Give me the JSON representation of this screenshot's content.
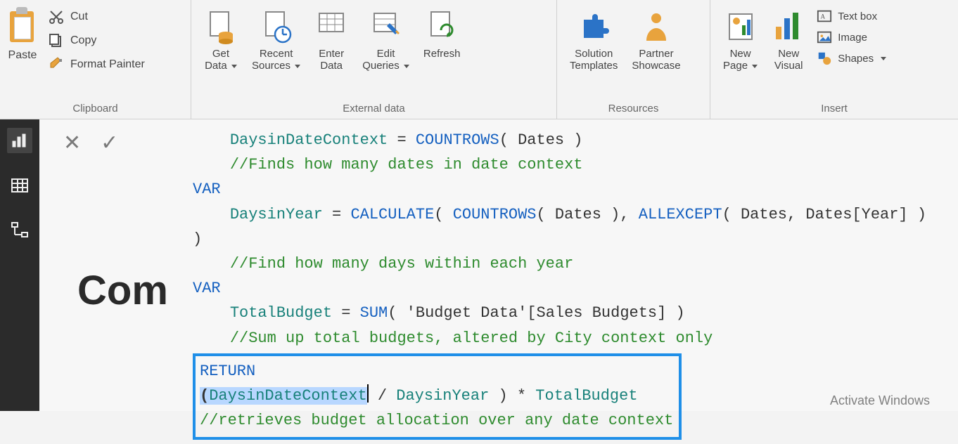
{
  "ribbon": {
    "clipboard": {
      "group_label": "Clipboard",
      "paste": "Paste",
      "cut": "Cut",
      "copy": "Copy",
      "format_painter": "Format Painter"
    },
    "external_data": {
      "group_label": "External data",
      "get_data": "Get\nData",
      "recent_sources": "Recent\nSources",
      "enter_data": "Enter\nData",
      "edit_queries": "Edit\nQueries",
      "refresh": "Refresh"
    },
    "resources": {
      "group_label": "Resources",
      "solution_templates": "Solution\nTemplates",
      "partner_showcase": "Partner\nShowcase"
    },
    "insert": {
      "group_label": "Insert",
      "new_page": "New\nPage",
      "new_visual": "New\nVisual",
      "text_box": "Text box",
      "image": "Image",
      "shapes": "Shapes"
    }
  },
  "canvas": {
    "page_title_partial": "Com"
  },
  "formula": {
    "line1_var": "DaysinDateContext",
    "line1_eq": " = ",
    "line1_fn": "COUNTROWS",
    "line1_arg": "( Dates )",
    "line1_comment": "//Finds how many dates in date context",
    "var2": "VAR",
    "line2_var": "DaysinYear",
    "line2_eq": " = ",
    "line2_fn1": "CALCULATE",
    "line2_open": "( ",
    "line2_fn2": "COUNTROWS",
    "line2_arg2": "( Dates ), ",
    "line2_fn3": "ALLEXCEPT",
    "line2_arg3": "( Dates, Dates[Year] ) )",
    "line2_comment": "//Find how many days within each year",
    "var3": "VAR",
    "line3_var": "TotalBudget",
    "line3_eq": " = ",
    "line3_fn": "SUM",
    "line3_arg": "( 'Budget Data'[Sales Budgets] )",
    "line3_comment": "//Sum up total budgets, altered by City context only",
    "return": "RETURN",
    "ret_open": "(",
    "ret_a": "DaysinDateContext",
    "ret_mid": " / ",
    "ret_b": "DaysinYear",
    "ret_close": " ) * ",
    "ret_c": "TotalBudget",
    "ret_comment": "//retrieves budget allocation over any date context"
  },
  "watermark": "Activate Windows"
}
